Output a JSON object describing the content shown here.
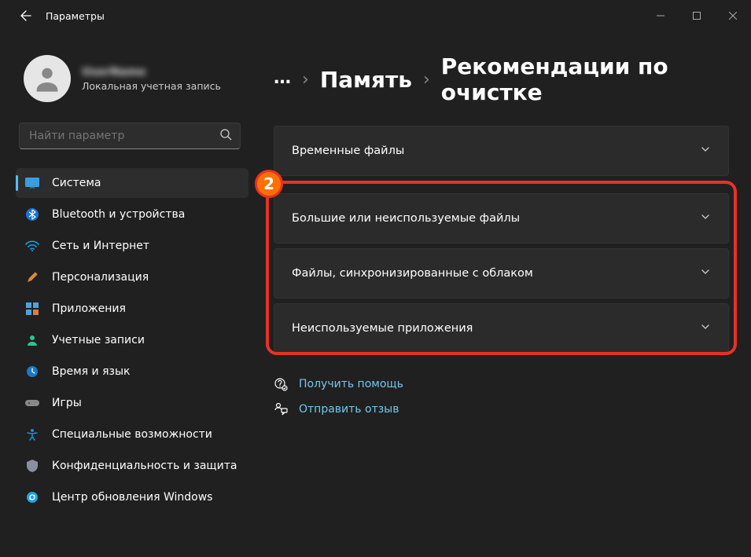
{
  "window": {
    "title": "Параметры"
  },
  "user": {
    "name": "UserName",
    "subtitle": "Локальная учетная запись"
  },
  "search": {
    "placeholder": "Найти параметр"
  },
  "nav": [
    {
      "id": "system",
      "label": "Система"
    },
    {
      "id": "bluetooth",
      "label": "Bluetooth и устройства"
    },
    {
      "id": "network",
      "label": "Сеть и Интернет"
    },
    {
      "id": "personalization",
      "label": "Персонализация"
    },
    {
      "id": "apps",
      "label": "Приложения"
    },
    {
      "id": "accounts",
      "label": "Учетные записи"
    },
    {
      "id": "time",
      "label": "Время и язык"
    },
    {
      "id": "gaming",
      "label": "Игры"
    },
    {
      "id": "accessibility",
      "label": "Специальные возможности"
    },
    {
      "id": "privacy",
      "label": "Конфиденциальность и защита"
    },
    {
      "id": "update",
      "label": "Центр обновления Windows"
    }
  ],
  "breadcrumb": {
    "dots": "…",
    "sep": "›",
    "parent": "Память",
    "current": "Рекомендации по очистке"
  },
  "cards": [
    {
      "id": "temp",
      "label": "Временные файлы"
    },
    {
      "id": "large",
      "label": "Большие или неиспользуемые файлы"
    },
    {
      "id": "cloud",
      "label": "Файлы, синхронизированные с облаком"
    },
    {
      "id": "unused",
      "label": "Неиспользуемые приложения"
    }
  ],
  "links": {
    "help": "Получить помощь",
    "feedback": "Отправить отзыв"
  },
  "annotation": {
    "badge": "2"
  }
}
